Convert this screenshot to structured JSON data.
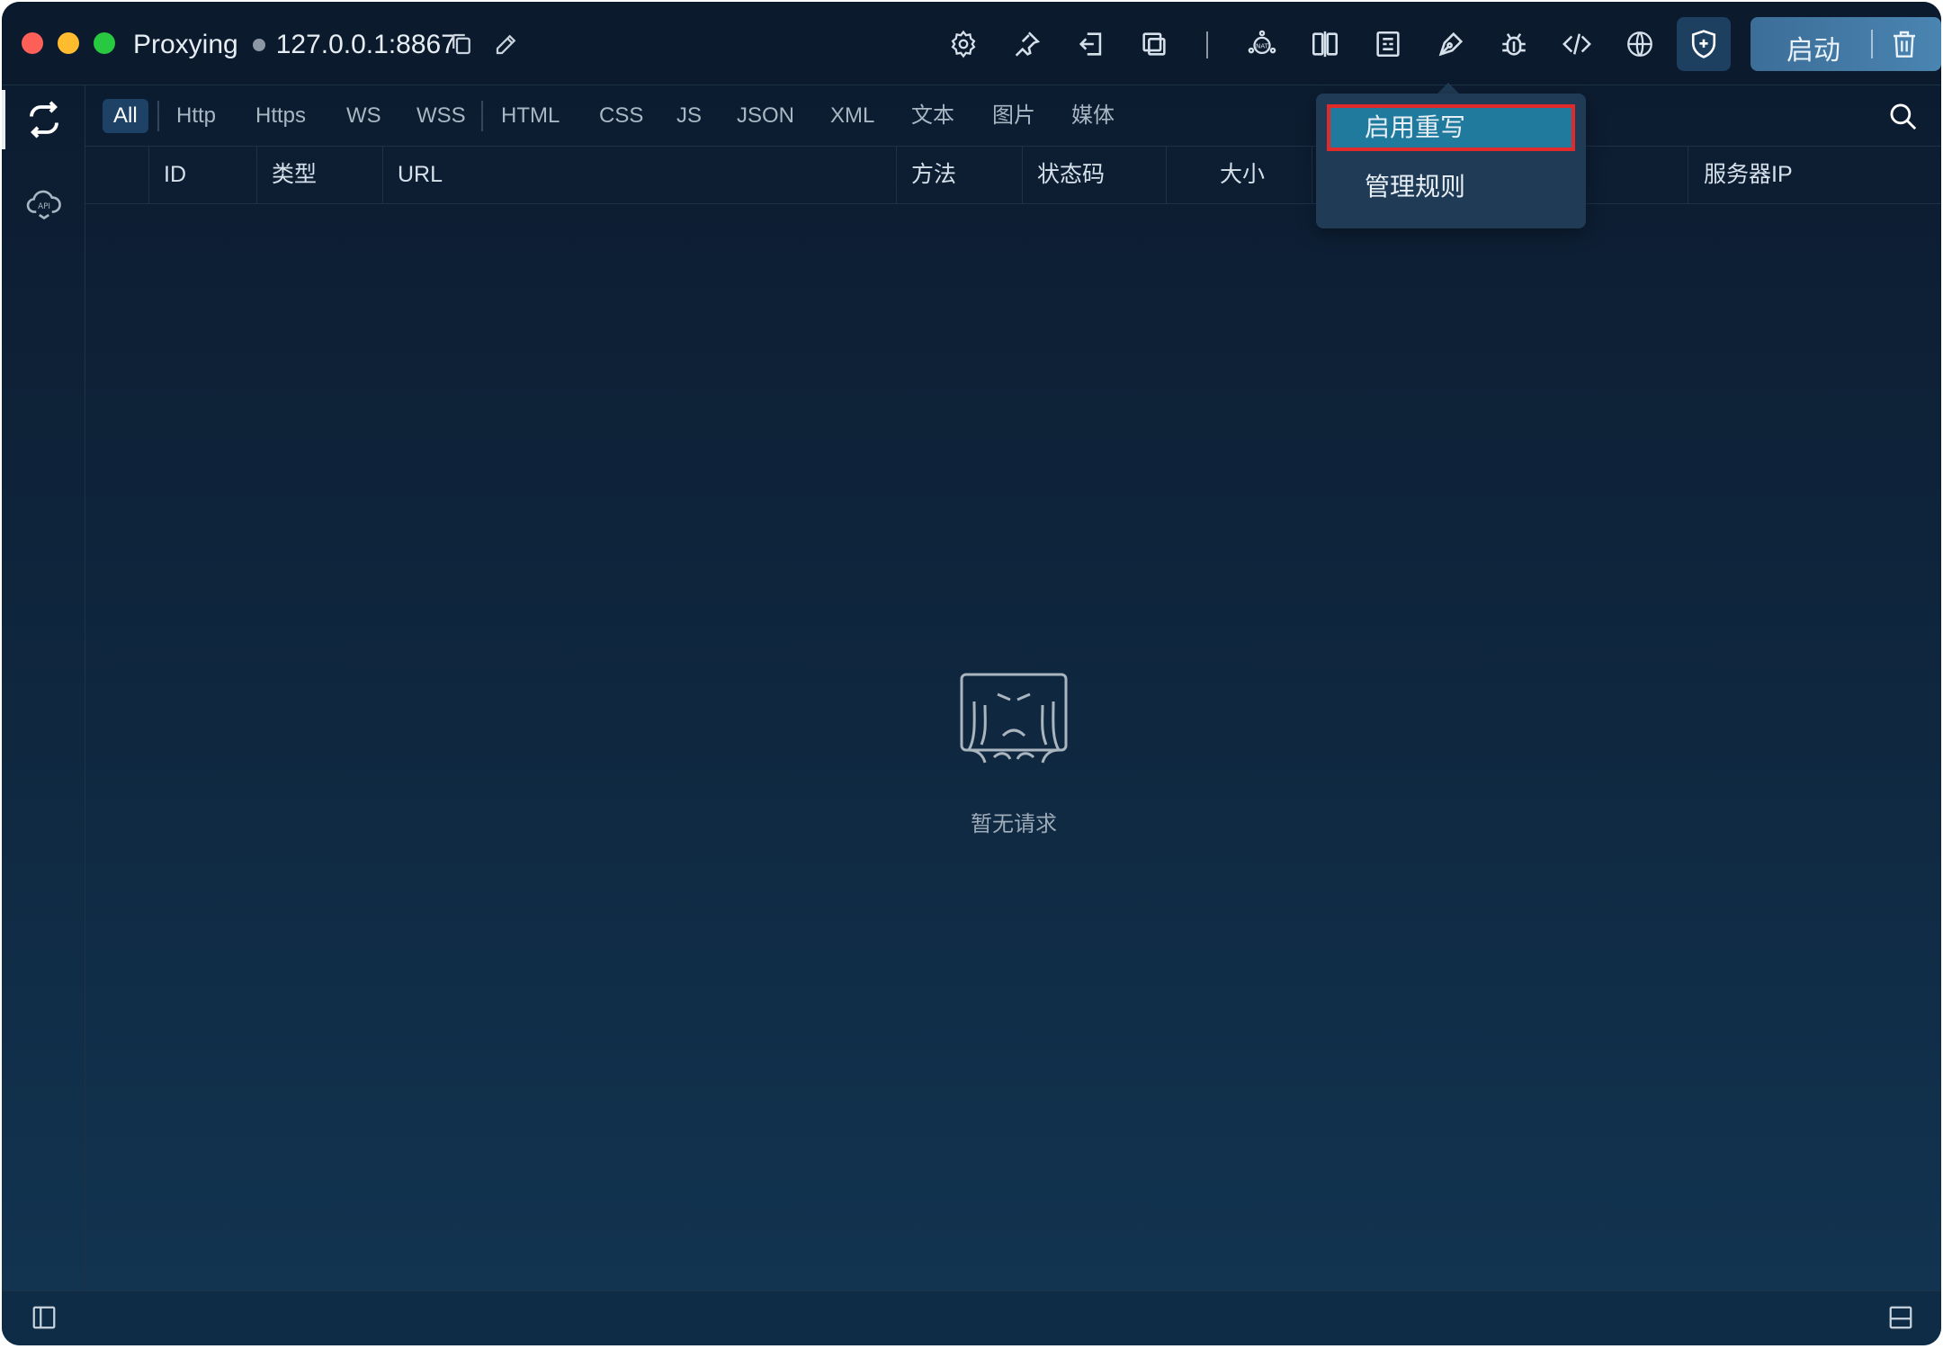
{
  "titlebar": {
    "status": "Proxying",
    "address": "127.0.0.1:8867",
    "start_label": "启动",
    "toolbar_icons": [
      "gear-icon",
      "pin-icon",
      "import-icon",
      "copy-window-icon",
      "nat-icon",
      "split-compare-icon",
      "breakpoint-icon",
      "rewrite-pen-icon",
      "bug-icon",
      "code-icon",
      "globe-icon"
    ]
  },
  "filters": [
    "All",
    "Http",
    "Https",
    "WS",
    "WSS",
    "HTML",
    "CSS",
    "JS",
    "JSON",
    "XML",
    "文本",
    "图片",
    "媒体"
  ],
  "active_filter": "All",
  "columns": [
    "ID",
    "类型",
    "URL",
    "方法",
    "状态码",
    "大小",
    "服务器IP"
  ],
  "empty_state": {
    "text": "暂无请求"
  },
  "dropdown": {
    "items": [
      "启用重写",
      "管理规则"
    ],
    "highlighted": "启用重写"
  },
  "colors": {
    "background": "#0c1a2e",
    "accent": "#4a84b1",
    "highlight_border": "#e12a2a",
    "menu_highlight": "#1f7a9e"
  }
}
